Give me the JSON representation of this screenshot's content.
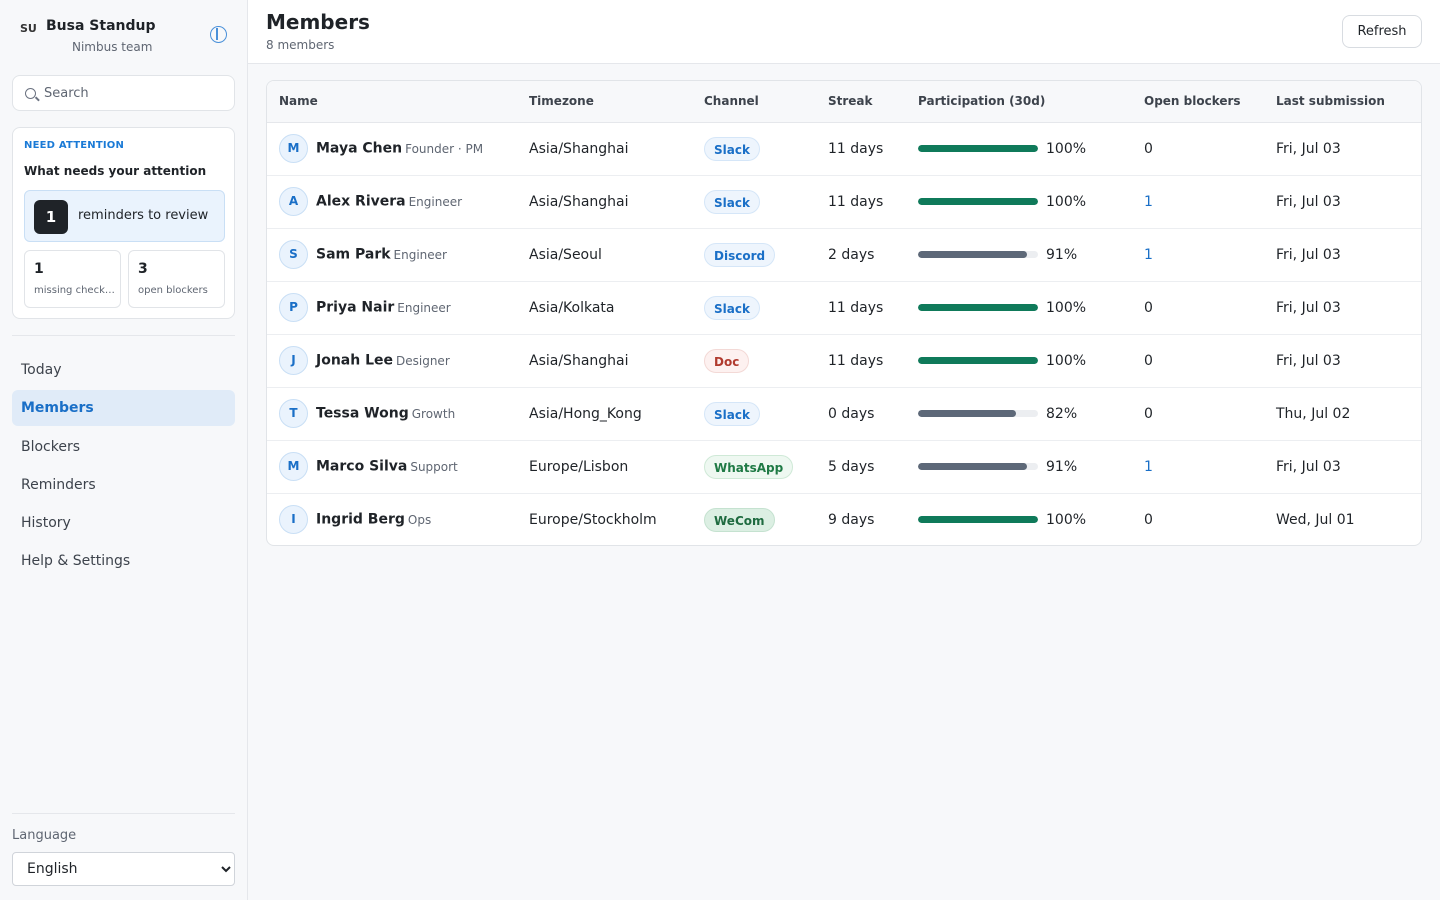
{
  "sidebar": {
    "logo": "SU",
    "app_name": "Busa Standup",
    "team": "Nimbus team",
    "search_placeholder": "Search",
    "attention": {
      "kicker": "NEED ATTENTION",
      "title": "What needs your attention",
      "reminders_count": "1",
      "reminders_label": "reminders to review",
      "stats": [
        {
          "num": "1",
          "label": "missing check-ins"
        },
        {
          "num": "3",
          "label": "open blockers"
        }
      ]
    },
    "nav": [
      {
        "label": "Today",
        "active": false
      },
      {
        "label": "Members",
        "active": true
      },
      {
        "label": "Blockers",
        "active": false
      },
      {
        "label": "Reminders",
        "active": false
      },
      {
        "label": "History",
        "active": false
      },
      {
        "label": "Help & Settings",
        "active": false
      }
    ],
    "language_label": "Language",
    "language_value": "English"
  },
  "header": {
    "title": "Members",
    "subtitle": "8 members",
    "refresh_label": "Refresh"
  },
  "table": {
    "columns": [
      "Name",
      "Timezone",
      "Channel",
      "Streak",
      "Participation (30d)",
      "Open blockers",
      "Last submission"
    ],
    "rows": [
      {
        "initial": "M",
        "name": "Maya Chen",
        "role": "Founder · PM",
        "timezone": "Asia/Shanghai",
        "channel": "Slack",
        "streak": "11 days",
        "participation": 100,
        "participation_label": "100%",
        "blockers": "0",
        "last": "Fri, Jul 03"
      },
      {
        "initial": "A",
        "name": "Alex Rivera",
        "role": "Engineer",
        "timezone": "Asia/Shanghai",
        "channel": "Slack",
        "streak": "11 days",
        "participation": 100,
        "participation_label": "100%",
        "blockers": "1",
        "last": "Fri, Jul 03"
      },
      {
        "initial": "S",
        "name": "Sam Park",
        "role": "Engineer",
        "timezone": "Asia/Seoul",
        "channel": "Discord",
        "streak": "2 days",
        "participation": 91,
        "participation_label": "91%",
        "blockers": "1",
        "last": "Fri, Jul 03"
      },
      {
        "initial": "P",
        "name": "Priya Nair",
        "role": "Engineer",
        "timezone": "Asia/Kolkata",
        "channel": "Slack",
        "streak": "11 days",
        "participation": 100,
        "participation_label": "100%",
        "blockers": "0",
        "last": "Fri, Jul 03"
      },
      {
        "initial": "J",
        "name": "Jonah Lee",
        "role": "Designer",
        "timezone": "Asia/Shanghai",
        "channel": "Doc",
        "streak": "11 days",
        "participation": 100,
        "participation_label": "100%",
        "blockers": "0",
        "last": "Fri, Jul 03"
      },
      {
        "initial": "T",
        "name": "Tessa Wong",
        "role": "Growth",
        "timezone": "Asia/Hong_Kong",
        "channel": "Slack",
        "streak": "0 days",
        "participation": 82,
        "participation_label": "82%",
        "blockers": "0",
        "last": "Thu, Jul 02"
      },
      {
        "initial": "M",
        "name": "Marco Silva",
        "role": "Support",
        "timezone": "Europe/Lisbon",
        "channel": "WhatsApp",
        "streak": "5 days",
        "participation": 91,
        "participation_label": "91%",
        "blockers": "1",
        "last": "Fri, Jul 03"
      },
      {
        "initial": "I",
        "name": "Ingrid Berg",
        "role": "Ops",
        "timezone": "Europe/Stockholm",
        "channel": "WeCom",
        "streak": "9 days",
        "participation": 100,
        "participation_label": "100%",
        "blockers": "0",
        "last": "Wed, Jul 01"
      }
    ]
  },
  "colors": {
    "accent": "#1a6fc7",
    "bar_full": "#0f7a5a",
    "bar_partial": "#5d6878",
    "channels": {
      "Slack": {
        "bg": "#eef5fd",
        "border": "#d5e6f8",
        "fg": "#1a6fc7"
      },
      "Discord": {
        "bg": "#eef5fd",
        "border": "#d5e6f8",
        "fg": "#1a6fc7"
      },
      "Doc": {
        "bg": "#fdf1f0",
        "border": "#f3d9d6",
        "fg": "#b03a2e"
      },
      "WhatsApp": {
        "bg": "#eef8f1",
        "border": "#cfe9d7",
        "fg": "#1f7a45"
      },
      "WeCom": {
        "bg": "#dcefe3",
        "border": "#c5e2d0",
        "fg": "#1f6b40"
      }
    }
  }
}
